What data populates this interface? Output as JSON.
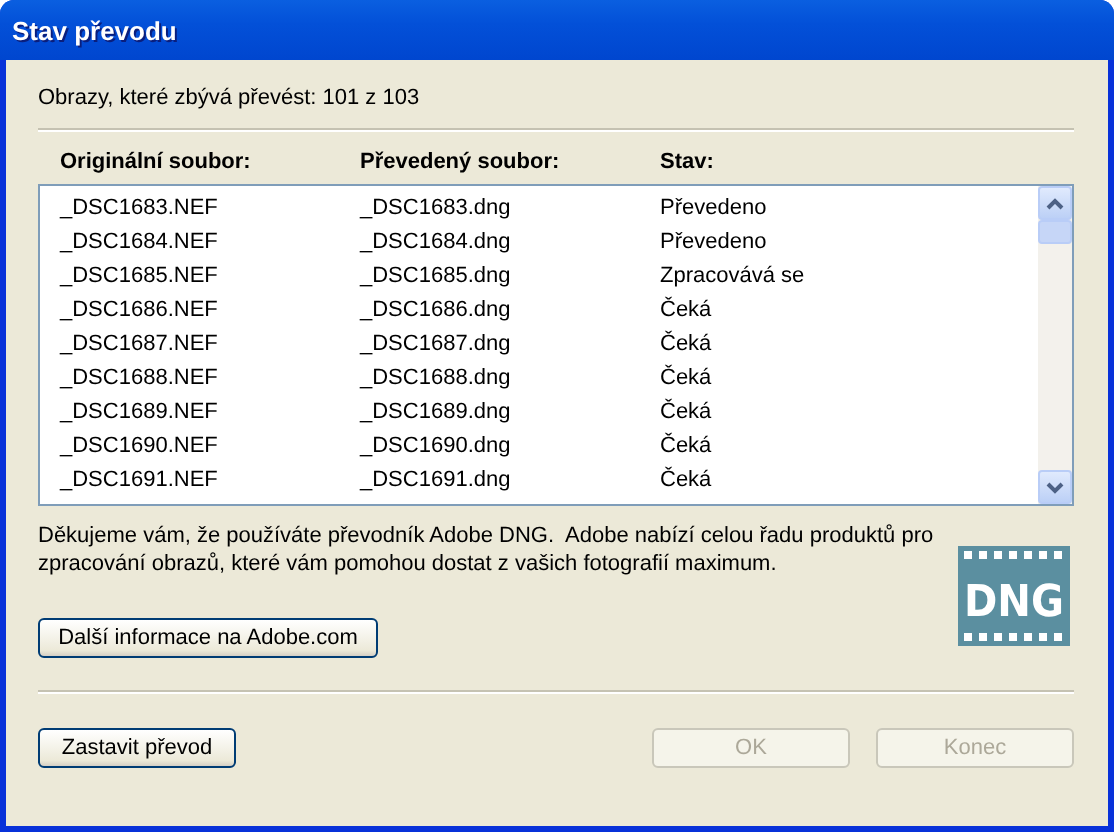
{
  "window": {
    "title": "Stav převodu"
  },
  "summary": "Obrazy, které zbývá převést: 101 z 103",
  "table": {
    "columns": [
      "Originální soubor:",
      "Převedený soubor:",
      "Stav:"
    ],
    "rows": [
      {
        "original": "_DSC1683.NEF",
        "converted": "_DSC1683.dng",
        "status": "Převedeno"
      },
      {
        "original": "_DSC1684.NEF",
        "converted": "_DSC1684.dng",
        "status": "Převedeno"
      },
      {
        "original": "_DSC1685.NEF",
        "converted": "_DSC1685.dng",
        "status": "Zpracovává se"
      },
      {
        "original": "_DSC1686.NEF",
        "converted": "_DSC1686.dng",
        "status": "Čeká"
      },
      {
        "original": "_DSC1687.NEF",
        "converted": "_DSC1687.dng",
        "status": "Čeká"
      },
      {
        "original": "_DSC1688.NEF",
        "converted": "_DSC1688.dng",
        "status": "Čeká"
      },
      {
        "original": "_DSC1689.NEF",
        "converted": "_DSC1689.dng",
        "status": "Čeká"
      },
      {
        "original": "_DSC1690.NEF",
        "converted": "_DSC1690.dng",
        "status": "Čeká"
      },
      {
        "original": "_DSC1691.NEF",
        "converted": "_DSC1691.dng",
        "status": "Čeká"
      }
    ]
  },
  "message": "Děkujeme vám, že používáte převodník Adobe DNG.  Adobe nabízí celou řadu produktů pro zpracování obrazů, které vám pomohou dostat z vašich fotografií maximum.",
  "logo": {
    "text": "DNG"
  },
  "info_button": {
    "label": "Další informace na Adobe.com",
    "disabled": false
  },
  "buttons": [
    {
      "label": "Zastavit převod",
      "disabled": false
    },
    {
      "label": "OK",
      "disabled": true
    },
    {
      "label": "Konec",
      "disabled": true
    }
  ]
}
